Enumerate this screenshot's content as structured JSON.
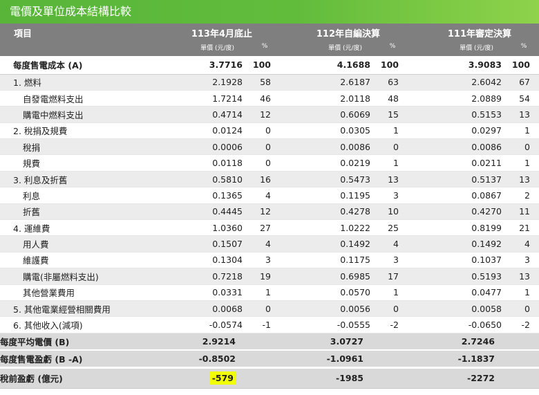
{
  "title": "電價及單位成本結構比較",
  "header": {
    "item_label": "項目",
    "groups": [
      "113年4月底止",
      "112年自編決算",
      "111年審定決算"
    ],
    "unit_label": "單價 (元/度)",
    "pct_label": "%"
  },
  "rows": [
    {
      "name": "每度售電成本 (A)",
      "v": [
        "3.7716",
        "4.1688",
        "3.9083"
      ],
      "p": [
        "100",
        "100",
        "100"
      ]
    },
    {
      "name": "1. 燃料",
      "v": [
        "2.1928",
        "2.6187",
        "2.6042"
      ],
      "p": [
        "58",
        "63",
        "67"
      ]
    },
    {
      "name": "自發電燃料支出",
      "v": [
        "1.7214",
        "2.0118",
        "2.0889"
      ],
      "p": [
        "46",
        "48",
        "54"
      ]
    },
    {
      "name": "購電中燃料支出",
      "v": [
        "0.4714",
        "0.6069",
        "0.5153"
      ],
      "p": [
        "12",
        "15",
        "13"
      ]
    },
    {
      "name": "2. 稅捐及規費",
      "v": [
        "0.0124",
        "0.0305",
        "0.0297"
      ],
      "p": [
        "0",
        "1",
        "1"
      ]
    },
    {
      "name": "稅捐",
      "v": [
        "0.0006",
        "0.0086",
        "0.0086"
      ],
      "p": [
        "0",
        "0",
        "0"
      ]
    },
    {
      "name": "規費",
      "v": [
        "0.0118",
        "0.0219",
        "0.0211"
      ],
      "p": [
        "0",
        "1",
        "1"
      ]
    },
    {
      "name": "3. 利息及折舊",
      "v": [
        "0.5810",
        "0.5473",
        "0.5137"
      ],
      "p": [
        "16",
        "13",
        "13"
      ]
    },
    {
      "name": "利息",
      "v": [
        "0.1365",
        "0.1195",
        "0.0867"
      ],
      "p": [
        "4",
        "3",
        "2"
      ]
    },
    {
      "name": "折舊",
      "v": [
        "0.4445",
        "0.4278",
        "0.4270"
      ],
      "p": [
        "12",
        "10",
        "11"
      ]
    },
    {
      "name": "4. 運維費",
      "v": [
        "1.0360",
        "1.0222",
        "0.8199"
      ],
      "p": [
        "27",
        "25",
        "21"
      ]
    },
    {
      "name": "用人費",
      "v": [
        "0.1507",
        "0.1492",
        "0.1492"
      ],
      "p": [
        "4",
        "4",
        "4"
      ]
    },
    {
      "name": "維護費",
      "v": [
        "0.1304",
        "0.1175",
        "0.1037"
      ],
      "p": [
        "3",
        "3",
        "3"
      ]
    },
    {
      "name": "購電(非屬燃料支出)",
      "v": [
        "0.7218",
        "0.6985",
        "0.5193"
      ],
      "p": [
        "19",
        "17",
        "13"
      ]
    },
    {
      "name": "其他營業費用",
      "v": [
        "0.0331",
        "0.0570",
        "0.0477"
      ],
      "p": [
        "1",
        "1",
        "1"
      ]
    },
    {
      "name": "5. 其他電業經營相關費用",
      "v": [
        "0.0068",
        "0.0056",
        "0.0058"
      ],
      "p": [
        "0",
        "0",
        "0"
      ]
    },
    {
      "name": "6. 其他收入(減項)",
      "v": [
        "-0.0574",
        "-0.0555",
        "-0.0650"
      ],
      "p": [
        "-1",
        "-2",
        "-2"
      ]
    }
  ],
  "summary": [
    {
      "name": "每度平均電價 (B)",
      "v": [
        "2.9214",
        "3.0727",
        "2.7246"
      ]
    },
    {
      "name": "每度售電盈虧 (B -A)",
      "v": [
        "-0.8502",
        "-1.0961",
        "-1.1837"
      ]
    },
    {
      "name": "稅前盈虧 (億元)",
      "v": [
        "-579",
        "-1985",
        "-2272"
      ]
    }
  ],
  "colors": {
    "title_bar": "#62bc3c",
    "header_bg": "#7f7f7f",
    "row_stripe": "#ececec",
    "summary_bg": "#d9d9d9",
    "highlight": "#f2ff00"
  }
}
